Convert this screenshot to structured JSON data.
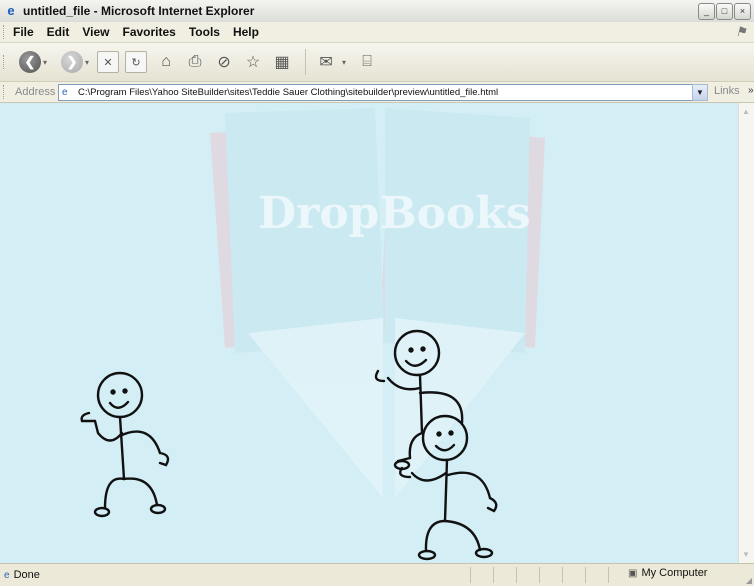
{
  "window": {
    "title": "untitled_file - Microsoft Internet Explorer"
  },
  "menubar": {
    "items": [
      "File",
      "Edit",
      "View",
      "Favorites",
      "Tools",
      "Help"
    ]
  },
  "address": {
    "label": "Address",
    "url": "C:\\Program Files\\Yahoo SiteBuilder\\sites\\Teddie Sauer Clothing\\sitebuilder\\preview\\untitled_file.html"
  },
  "links": {
    "label": "Links"
  },
  "watermark": {
    "text": "DropBooks"
  },
  "status": {
    "text": "Done",
    "zone": "My Computer"
  },
  "icons": {
    "back": "back-arrow-icon",
    "forward": "forward-arrow-icon",
    "stop": "stop-icon",
    "refresh": "refresh-icon",
    "home": "home-icon",
    "print": "print-icon",
    "search": "search-icon",
    "favorites": "star-icon",
    "media": "media-icon",
    "mail": "mail-icon",
    "messenger": "messenger-icon"
  },
  "colors": {
    "content_bg": "#d4eef5",
    "ie_blue": "#1d5fbf"
  }
}
